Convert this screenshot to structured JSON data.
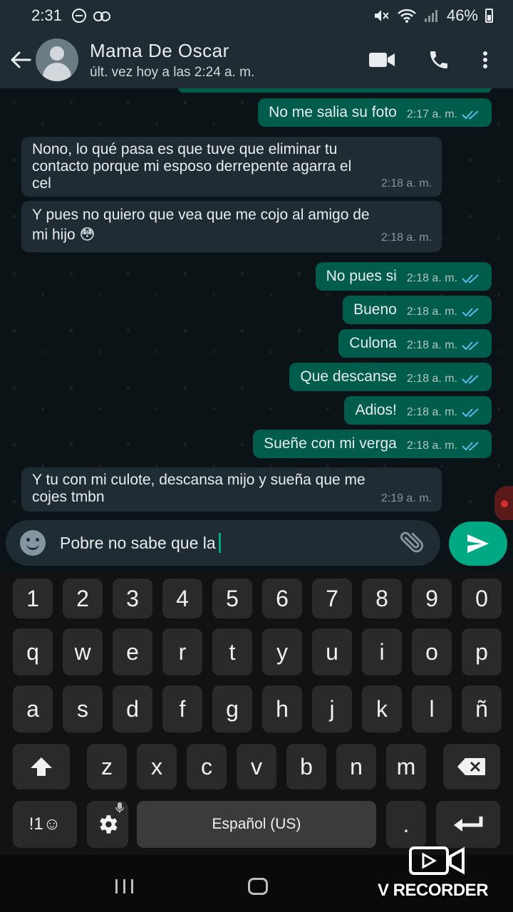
{
  "status_bar": {
    "time": "2:31",
    "battery": "46%"
  },
  "header": {
    "contact_name": "Mama De Oscar",
    "last_seen": "últ. vez hoy a las 2:24 a. m."
  },
  "messages": [
    {
      "dir": "out",
      "text": "No me salia su foto",
      "time": "2:17 a. m.",
      "status": "read"
    },
    {
      "dir": "in",
      "lines": [
        "Nono, lo qué pasa es que tuve que eliminar tu",
        "contacto porque mi esposo derrepente agarra el",
        "cel"
      ],
      "time": "2:18 a. m."
    },
    {
      "dir": "in",
      "lines": [
        "Y pues no quiero que vea que me cojo al amigo de",
        "mi hijo 😳"
      ],
      "time": "2:18 a. m."
    },
    {
      "dir": "out",
      "text": "No pues si",
      "time": "2:18 a. m.",
      "status": "read"
    },
    {
      "dir": "out",
      "text": "Bueno",
      "time": "2:18 a. m.",
      "status": "read"
    },
    {
      "dir": "out",
      "text": "Culona",
      "time": "2:18 a. m.",
      "status": "read"
    },
    {
      "dir": "out",
      "text": "Que descanse",
      "time": "2:18 a. m.",
      "status": "read"
    },
    {
      "dir": "out",
      "text": "Adios!",
      "time": "2:18 a. m.",
      "status": "read"
    },
    {
      "dir": "out",
      "text": "Sueñe con mi verga",
      "time": "2:18 a. m.",
      "status": "read"
    },
    {
      "dir": "in",
      "lines": [
        "Y tu con mi culote, descansa mijo y sueña que me",
        "cojes tmbn"
      ],
      "time": "2:19 a. m."
    }
  ],
  "composer": {
    "value": "Pobre no sabe que la"
  },
  "keyboard": {
    "row_numbers": [
      "1",
      "2",
      "3",
      "4",
      "5",
      "6",
      "7",
      "8",
      "9",
      "0"
    ],
    "row1": [
      "q",
      "w",
      "e",
      "r",
      "t",
      "y",
      "u",
      "i",
      "o",
      "p"
    ],
    "row2": [
      "a",
      "s",
      "d",
      "f",
      "g",
      "h",
      "j",
      "k",
      "l",
      "ñ"
    ],
    "row3": [
      "z",
      "x",
      "c",
      "v",
      "b",
      "n",
      "m"
    ],
    "symbols_label": "!1☺",
    "space_label": "Español (US)",
    "period_label": "."
  },
  "watermark": {
    "text": "V RECORDER"
  },
  "colors": {
    "accent": "#00a884",
    "outgoing_bubble": "#005c4b",
    "incoming_bubble": "#1f2c33",
    "read_ticks": "#53bdeb"
  }
}
